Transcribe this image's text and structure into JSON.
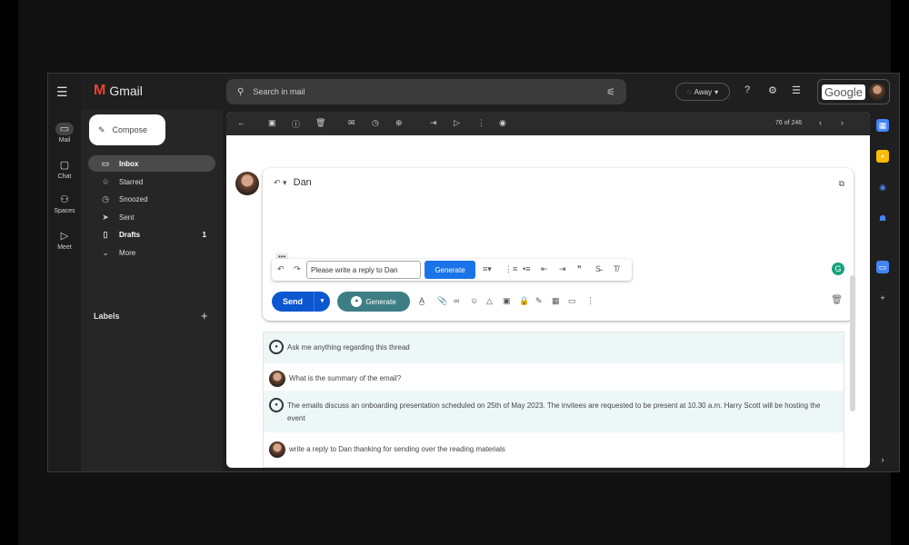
{
  "app": {
    "name": "Gmail"
  },
  "rail": [
    {
      "label": "Mail",
      "icon": "mail-icon",
      "glyph": "▭"
    },
    {
      "label": "Chat",
      "icon": "chat-icon",
      "glyph": "▢"
    },
    {
      "label": "Spaces",
      "icon": "spaces-icon",
      "glyph": "⚇"
    },
    {
      "label": "Meet",
      "icon": "meet-icon",
      "glyph": "▷"
    }
  ],
  "compose_label": "Compose",
  "nav": [
    {
      "label": "Inbox",
      "icon": "inbox-icon",
      "glyph": "▭",
      "count": ""
    },
    {
      "label": "Starred",
      "icon": "star-icon",
      "glyph": "☆",
      "count": ""
    },
    {
      "label": "Snoozed",
      "icon": "clock-icon",
      "glyph": "◷",
      "count": ""
    },
    {
      "label": "Sent",
      "icon": "send-icon",
      "glyph": "➤",
      "count": ""
    },
    {
      "label": "Drafts",
      "icon": "draft-icon",
      "glyph": "▯",
      "count": "1"
    },
    {
      "label": "More",
      "icon": "chevron-down-icon",
      "glyph": "⌄",
      "count": ""
    }
  ],
  "labels_heading": "Labels",
  "search": {
    "placeholder": "Search in mail"
  },
  "status": {
    "label": "Away"
  },
  "account": {
    "brand": "Google"
  },
  "toolbar": {
    "page_info": "76 of 246"
  },
  "reply": {
    "to": "Dan",
    "prompt_value": "Please write a reply to Dan",
    "generate_label": "Generate",
    "send_label": "Send",
    "generate2_label": "Generate"
  },
  "chat": {
    "messages": [
      {
        "role": "bot",
        "text": "Ask me anything regarding this thread"
      },
      {
        "role": "user",
        "text": "What is the summary of the email?"
      },
      {
        "role": "bot",
        "text": "The emails discuss an onboarding presentation scheduled on 25th of May 2023. The invitees are requested to be present at 10.30 a.m. Harry Scott will be hosting the event"
      },
      {
        "role": "user",
        "text": "write a reply to Dan thanking for sending over the reading materials"
      }
    ]
  },
  "colors": {
    "accent": "#1a73e8",
    "send": "#0b57d0",
    "generate": "#3d7d84",
    "bot_bg": "#eef7f8"
  }
}
